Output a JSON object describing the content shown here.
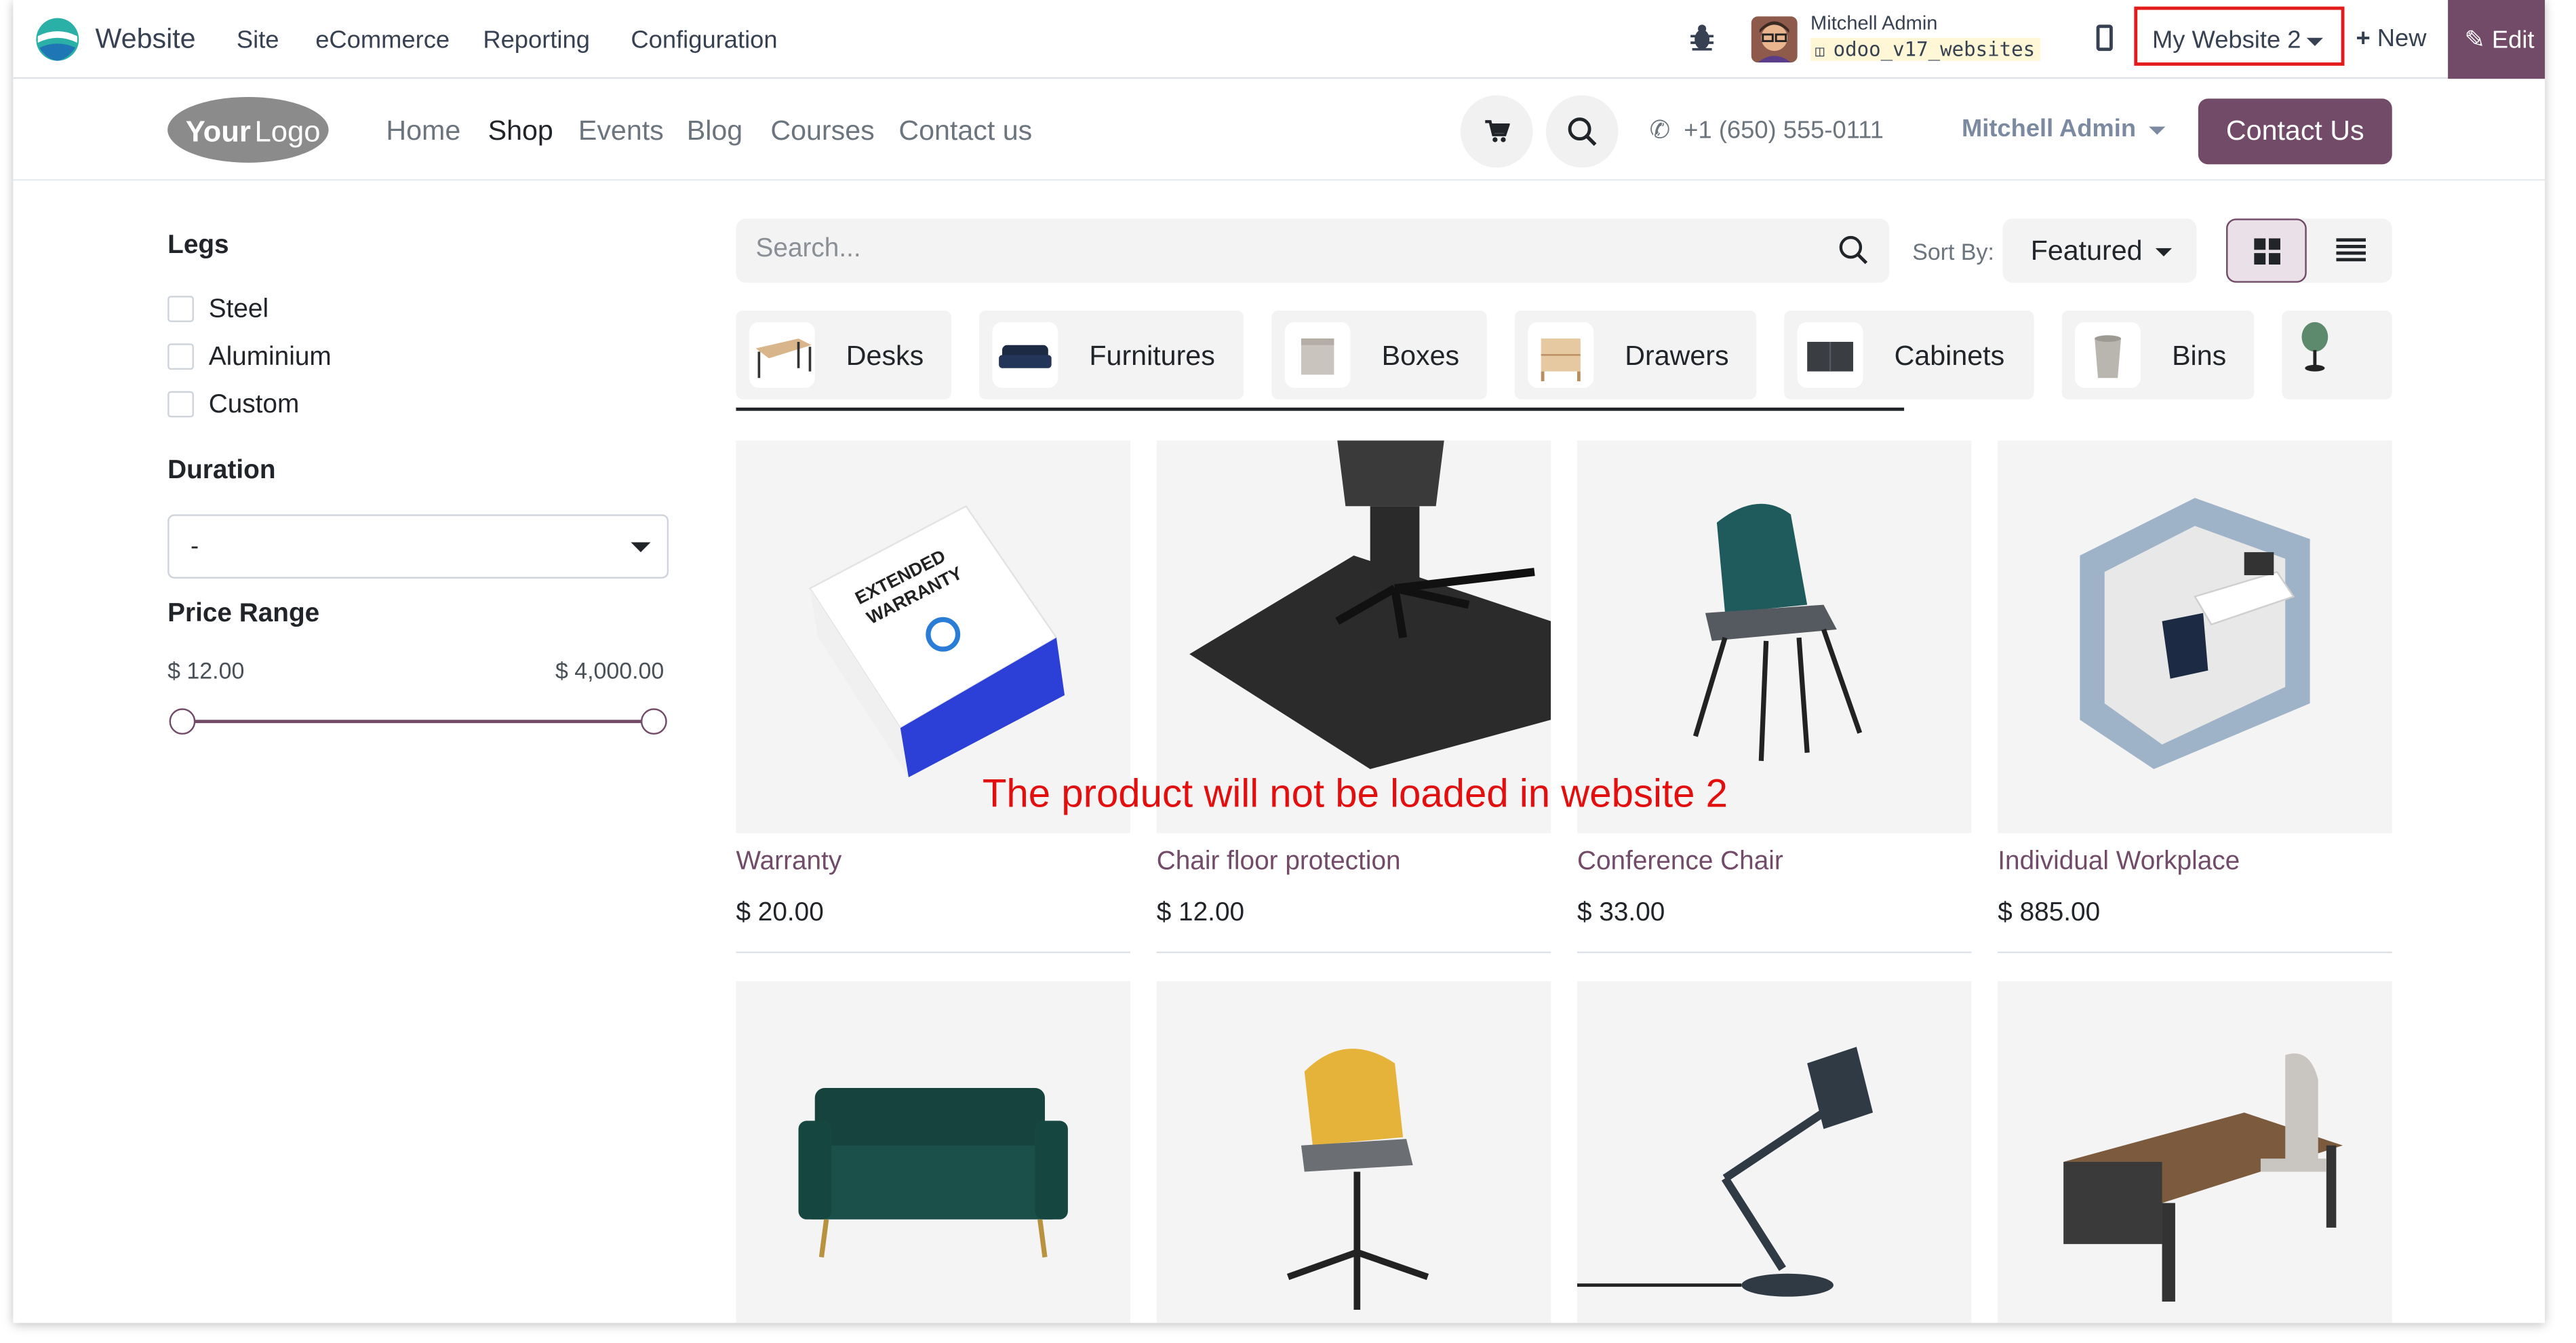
{
  "backend_nav": {
    "app_name": "Website",
    "menus": [
      "Site",
      "eCommerce",
      "Reporting",
      "Configuration"
    ],
    "user_name": "Mitchell Admin",
    "db_name": "odoo_v17_websites",
    "website_switcher": "My Website 2",
    "new_label": "New",
    "edit_label": "Edit"
  },
  "site_header": {
    "logo_text": "YourLogo",
    "nav": [
      "Home",
      "Shop",
      "Events",
      "Blog",
      "Courses",
      "Contact us"
    ],
    "active_nav": "Shop",
    "phone": "+1 (650) 555-0111",
    "user": "Mitchell Admin",
    "contact_button": "Contact Us"
  },
  "sidebar": {
    "legs_title": "Legs",
    "legs_options": [
      "Steel",
      "Aluminium",
      "Custom"
    ],
    "duration_title": "Duration",
    "duration_value": "-",
    "price_title": "Price Range",
    "price_min": "$ 12.00",
    "price_max": "$ 4,000.00"
  },
  "toolbar": {
    "search_placeholder": "Search...",
    "sort_label": "Sort By:",
    "sort_value": "Featured"
  },
  "categories": [
    "Desks",
    "Furnitures",
    "Boxes",
    "Drawers",
    "Cabinets",
    "Bins"
  ],
  "products": [
    {
      "name": "Warranty",
      "price": "$ 20.00"
    },
    {
      "name": "Chair floor protection",
      "price": "$ 12.00"
    },
    {
      "name": "Conference Chair",
      "price": "$ 33.00"
    },
    {
      "name": "Individual Workplace",
      "price": "$ 885.00"
    }
  ],
  "second_row_products": [
    "sofa",
    "office-chair",
    "desk-lamp",
    "desk-set"
  ],
  "annotation": "The product will not be loaded in website 2",
  "colors": {
    "brand": "#714b67",
    "highlight_border": "#e31b1b",
    "annotation": "#e30e0e"
  }
}
